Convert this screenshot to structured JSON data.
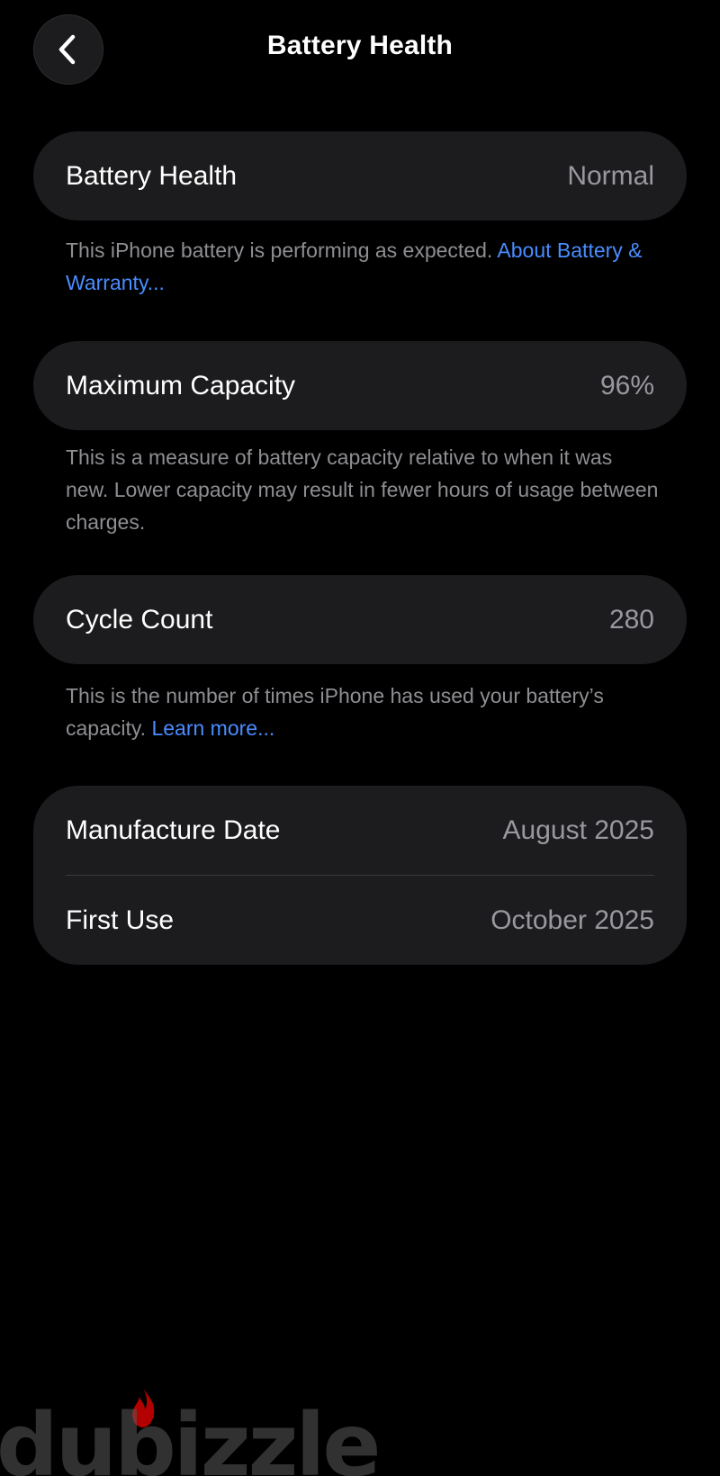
{
  "header": {
    "title": "Battery Health"
  },
  "battery_health": {
    "label": "Battery Health",
    "value": "Normal",
    "footnote_text": "This iPhone battery is performing as expected. ",
    "footnote_link": "About Battery & Warranty..."
  },
  "maximum_capacity": {
    "label": "Maximum Capacity",
    "value": "96%",
    "footnote_text": "This is a measure of battery capacity relative to when it was new. Lower capacity may result in fewer hours of usage between charges."
  },
  "cycle_count": {
    "label": "Cycle Count",
    "value": "280",
    "footnote_text": "This is the number of times iPhone has used your battery’s capacity. ",
    "footnote_link": "Learn more..."
  },
  "dates": {
    "manufacture_label": "Manufacture Date",
    "manufacture_value": "August 2025",
    "first_use_label": "First Use",
    "first_use_value": "October 2025"
  },
  "watermark": {
    "text": "dubizzle"
  },
  "colors": {
    "background": "#000000",
    "card": "#1c1c1e",
    "link": "#4a8cff",
    "secondary_text": "#98989f",
    "watermark_flame": "#e00000"
  },
  "icons": {
    "back": "chevron-left-icon",
    "watermark_flame": "flame-icon"
  }
}
